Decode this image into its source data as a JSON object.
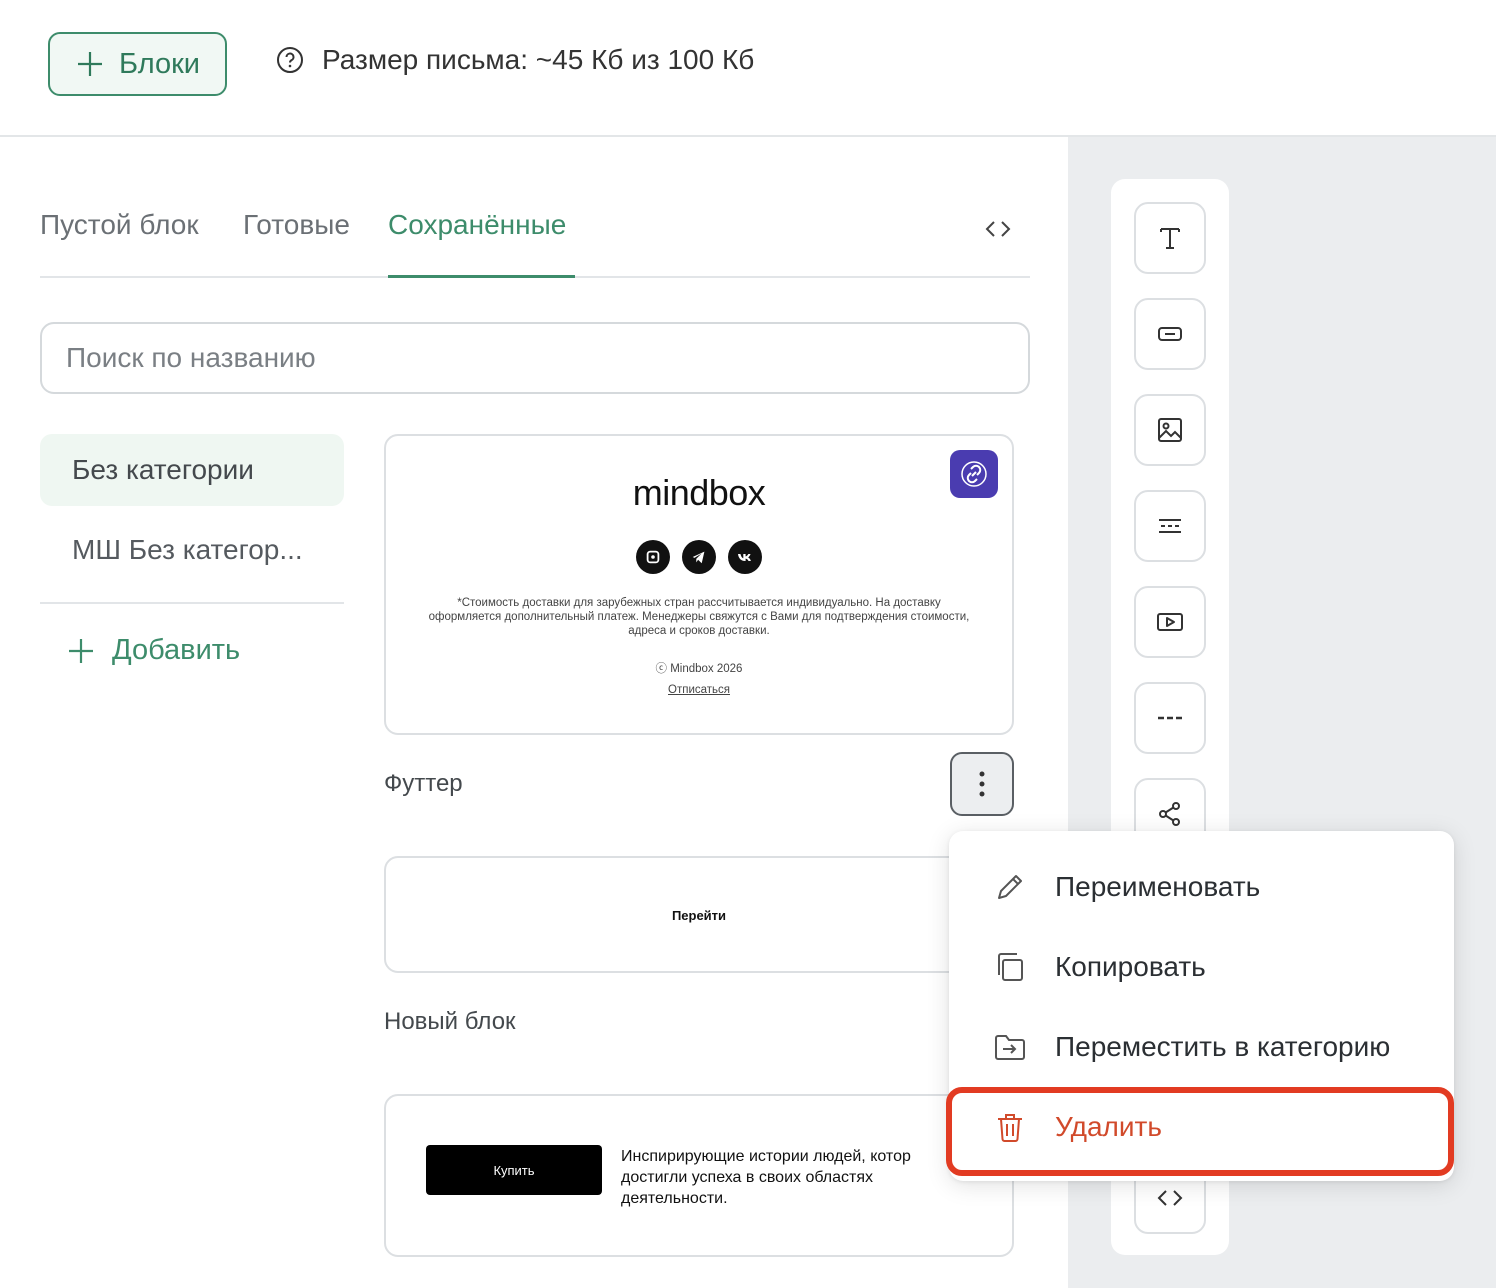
{
  "topbar": {
    "blocks_button": "Блоки",
    "size_info": "Размер письма: ~45 Кб из 100 Кб"
  },
  "tabs": [
    {
      "label": "Пустой блок",
      "active": false
    },
    {
      "label": "Готовые",
      "active": false
    },
    {
      "label": "Сохранённые",
      "active": true
    }
  ],
  "search": {
    "placeholder": "Поиск по названию",
    "value": ""
  },
  "categories": [
    {
      "label": "Без категории",
      "active": true
    },
    {
      "label": "МШ Без категор...",
      "active": false
    }
  ],
  "add_category": "Добавить",
  "blocks": [
    {
      "name": "Футтер",
      "preview": {
        "logo": "mindbox",
        "socials": [
          "max-icon",
          "telegram-icon",
          "vk-icon"
        ],
        "text": "*Стоимость доставки для зарубежных стран рассчитывается индивидуально. На доставку оформляется дополнительный платеж. Менеджеры свяжутся с Вами для подтверждения стоимости, адреса и сроков доставки.",
        "copyright": "ⓒ Mindbox 2026",
        "unsubscribe": "Отписаться"
      }
    },
    {
      "name": "Новый блок",
      "preview": {
        "button": "Перейти"
      }
    },
    {
      "name": "",
      "preview": {
        "button": "Купить",
        "text_lines": [
          "Инспирирующие истории людей, котор",
          "достигли успеха в своих областях",
          "деятельности."
        ]
      }
    }
  ],
  "menu": [
    {
      "label": "Переименовать",
      "icon": "pencil-icon"
    },
    {
      "label": "Копировать",
      "icon": "copy-icon"
    },
    {
      "label": "Переместить в категорию",
      "icon": "move-folder-icon"
    },
    {
      "label": "Удалить",
      "icon": "trash-icon",
      "danger": true
    }
  ],
  "toolbar": [
    "text-icon",
    "button-icon",
    "image-icon",
    "divider-text-icon",
    "video-icon",
    "dashed-line-icon",
    "share-icon",
    "code-icon"
  ],
  "colors": {
    "accent": "#3d8c6b",
    "danger": "#d14a2b",
    "highlight": "#e23b22",
    "link_badge": "#4a3cb0"
  }
}
